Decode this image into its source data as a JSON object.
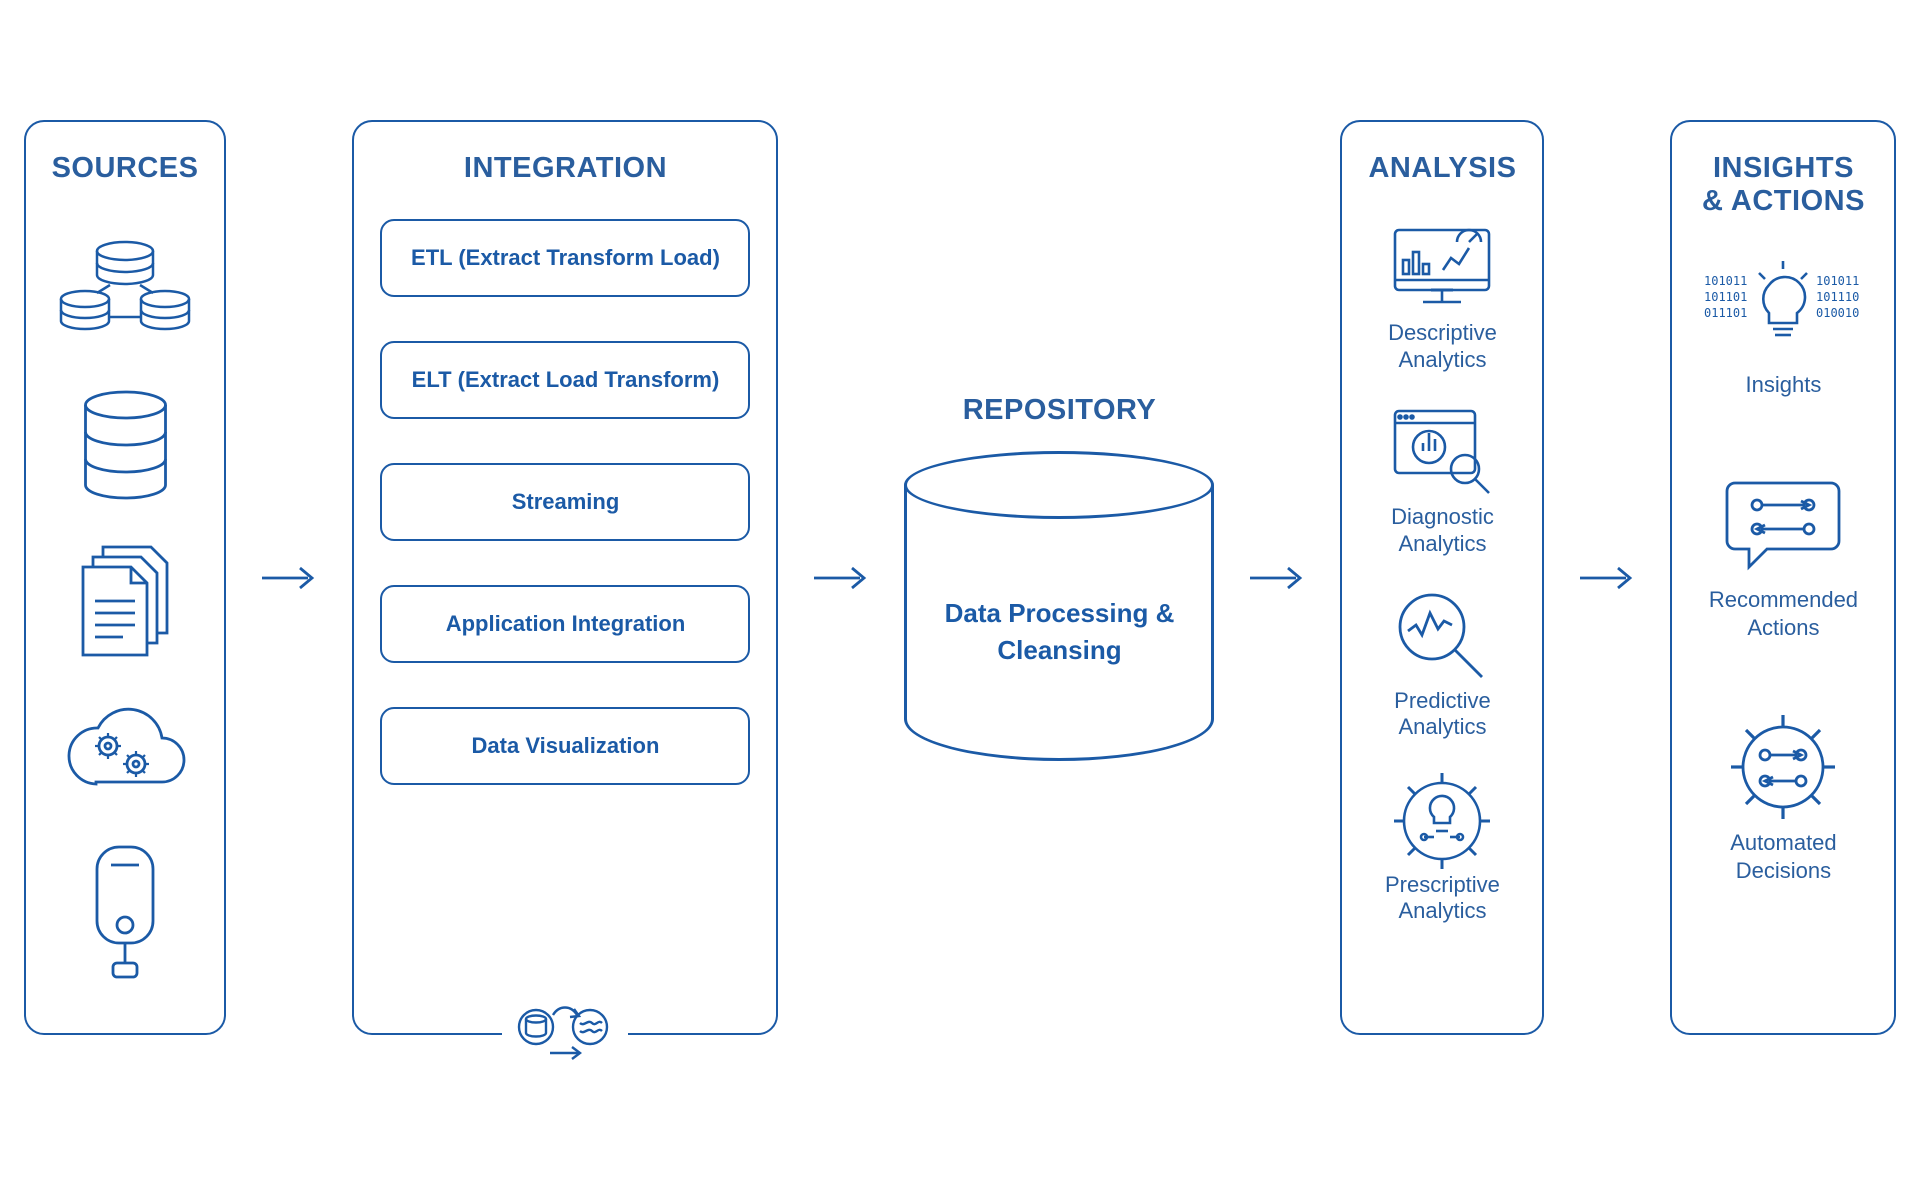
{
  "colors": {
    "blue": "#1b5aa6"
  },
  "sources": {
    "title": "SOURCES",
    "items": [
      {
        "icon": "database-cluster-icon"
      },
      {
        "icon": "database-icon"
      },
      {
        "icon": "documents-icon"
      },
      {
        "icon": "cloud-gears-icon"
      },
      {
        "icon": "server-icon"
      }
    ]
  },
  "integration": {
    "title": "INTEGRATION",
    "methods": [
      "ETL (Extract Transform Load)",
      "ELT (Extract Load Transform)",
      "Streaming",
      "Application Integration",
      "Data Visualization"
    ],
    "footer_icon": "transform-flow-icon"
  },
  "repository": {
    "title": "REPOSITORY",
    "body": "Data Processing & Cleansing"
  },
  "analysis": {
    "title": "ANALYSIS",
    "items": [
      {
        "label": "Descriptive Analytics",
        "icon": "dashboard-icon"
      },
      {
        "label": "Diagnostic Analytics",
        "icon": "chart-magnifier-icon"
      },
      {
        "label": "Predictive Analytics",
        "icon": "wave-magnifier-icon"
      },
      {
        "label": "Prescriptive Analytics",
        "icon": "gear-bulb-icon"
      }
    ]
  },
  "insights": {
    "title": "INSIGHTS & ACTIONS",
    "items": [
      {
        "label": "Insights",
        "icon": "bulb-binary-icon"
      },
      {
        "label": "Recommended Actions",
        "icon": "chat-flow-icon"
      },
      {
        "label": "Automated Decisions",
        "icon": "gear-flow-icon"
      }
    ]
  }
}
